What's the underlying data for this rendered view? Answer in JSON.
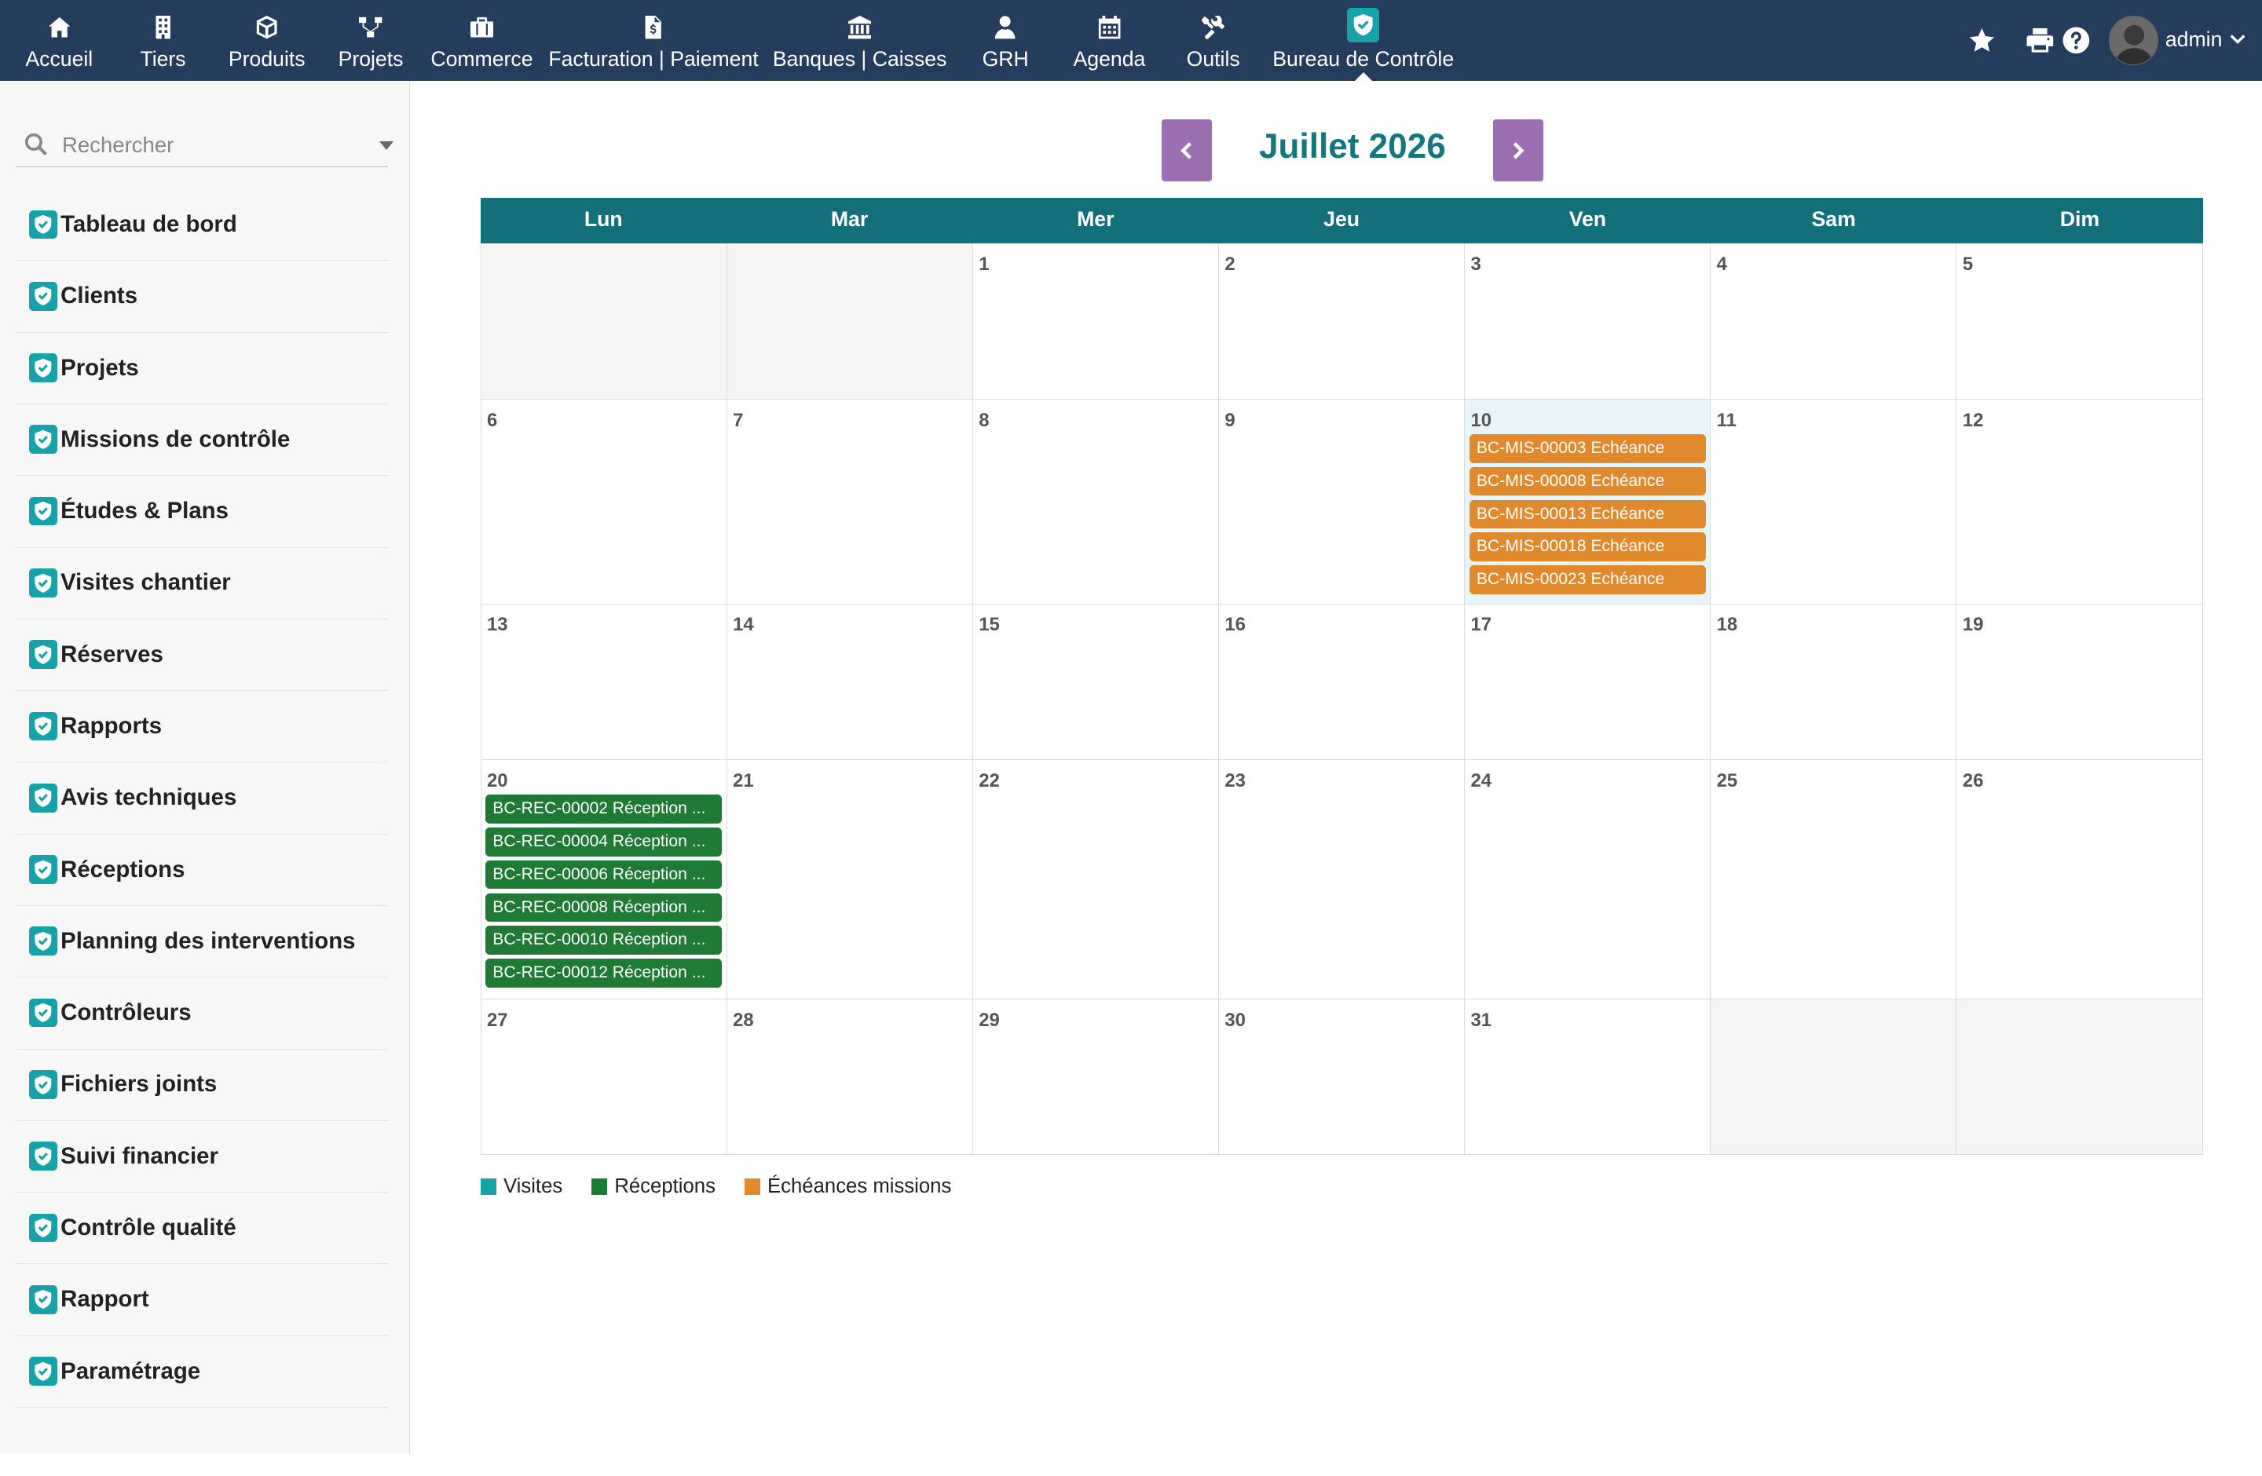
{
  "topnav": {
    "items": [
      {
        "label": "Accueil",
        "icon": "home-icon"
      },
      {
        "label": "Tiers",
        "icon": "building-icon"
      },
      {
        "label": "Produits",
        "icon": "cube-icon"
      },
      {
        "label": "Projets",
        "icon": "project-icon"
      },
      {
        "label": "Commerce",
        "icon": "briefcase-icon"
      },
      {
        "label": "Facturation | Paiement",
        "icon": "invoice-icon"
      },
      {
        "label": "Banques | Caisses",
        "icon": "bank-icon"
      },
      {
        "label": "GRH",
        "icon": "user-tie-icon"
      },
      {
        "label": "Agenda",
        "icon": "calendar-icon"
      },
      {
        "label": "Outils",
        "icon": "tools-icon"
      },
      {
        "label": "Bureau de Contrôle",
        "icon": "shield-check-icon",
        "active": true
      }
    ],
    "user": "admin"
  },
  "sidebar": {
    "search_placeholder": "Rechercher",
    "items": [
      "Tableau de bord",
      "Clients",
      "Projets",
      "Missions de contrôle",
      "Études & Plans",
      "Visites chantier",
      "Réserves",
      "Rapports",
      "Avis techniques",
      "Réceptions",
      "Planning des interventions",
      "Contrôleurs",
      "Fichiers joints",
      "Suivi financier",
      "Contrôle qualité",
      "Rapport",
      "Paramétrage"
    ]
  },
  "calendar": {
    "title": "Juillet 2026",
    "days_of_week": [
      "Lun",
      "Mar",
      "Mer",
      "Jeu",
      "Ven",
      "Sam",
      "Dim"
    ],
    "weeks": [
      [
        {
          "n": "",
          "out": true
        },
        {
          "n": "",
          "out": true
        },
        {
          "n": "1"
        },
        {
          "n": "2"
        },
        {
          "n": "3"
        },
        {
          "n": "4"
        },
        {
          "n": "5"
        }
      ],
      [
        {
          "n": "6"
        },
        {
          "n": "7"
        },
        {
          "n": "8"
        },
        {
          "n": "9"
        },
        {
          "n": "10",
          "today": true,
          "events": [
            {
              "label": "BC-MIS-00003 Echéance",
              "type": "orange"
            },
            {
              "label": "BC-MIS-00008 Echéance",
              "type": "orange"
            },
            {
              "label": "BC-MIS-00013 Echéance",
              "type": "orange"
            },
            {
              "label": "BC-MIS-00018 Echéance",
              "type": "orange"
            },
            {
              "label": "BC-MIS-00023 Echéance",
              "type": "orange"
            }
          ]
        },
        {
          "n": "11"
        },
        {
          "n": "12"
        }
      ],
      [
        {
          "n": "13"
        },
        {
          "n": "14"
        },
        {
          "n": "15"
        },
        {
          "n": "16"
        },
        {
          "n": "17"
        },
        {
          "n": "18"
        },
        {
          "n": "19"
        }
      ],
      [
        {
          "n": "20",
          "events": [
            {
              "label": "BC-REC-00002 Réception ...",
              "type": "green"
            },
            {
              "label": "BC-REC-00004 Réception ...",
              "type": "green"
            },
            {
              "label": "BC-REC-00006 Réception ...",
              "type": "green"
            },
            {
              "label": "BC-REC-00008 Réception ...",
              "type": "green"
            },
            {
              "label": "BC-REC-00010 Réception ...",
              "type": "green"
            },
            {
              "label": "BC-REC-00012 Réception ...",
              "type": "green"
            }
          ]
        },
        {
          "n": "21"
        },
        {
          "n": "22"
        },
        {
          "n": "23"
        },
        {
          "n": "24"
        },
        {
          "n": "25"
        },
        {
          "n": "26"
        }
      ],
      [
        {
          "n": "27"
        },
        {
          "n": "28"
        },
        {
          "n": "29"
        },
        {
          "n": "30"
        },
        {
          "n": "31"
        },
        {
          "n": "",
          "out": true
        },
        {
          "n": "",
          "out": true
        }
      ]
    ]
  },
  "legend": [
    {
      "label": "Visites",
      "color": "#16a2a6"
    },
    {
      "label": "Réceptions",
      "color": "#1f7a36"
    },
    {
      "label": "Échéances missions",
      "color": "#e08a2d"
    }
  ],
  "colors": {
    "topbar": "#263c5c",
    "accent": "#16a2a6",
    "calendar_header": "#13707a",
    "nav_button": "#9b6fb0"
  }
}
